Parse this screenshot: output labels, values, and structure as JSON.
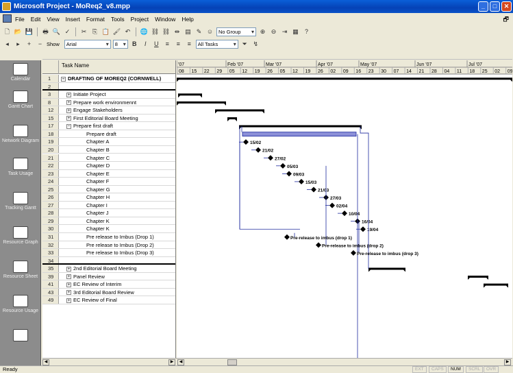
{
  "window": {
    "title": "Microsoft Project - MoReq2_v8.mpp"
  },
  "menu": [
    "File",
    "Edit",
    "View",
    "Insert",
    "Format",
    "Tools",
    "Project",
    "Window",
    "Help"
  ],
  "toolbar": {
    "group_value": "No Group",
    "font_value": "Arial",
    "font_size": "8",
    "filter_value": "All Tasks",
    "show_label": "Show"
  },
  "views": [
    "Calendar",
    "Gantt Chart",
    "Network Diagram",
    "Task Usage",
    "Tracking Gantt",
    "Resource Graph",
    "Resource Sheet",
    "Resource Usage"
  ],
  "table": {
    "header": "Task Name",
    "rows": [
      {
        "id": "1",
        "name": "DRAFTING OF MOREQ2 (CORNWELL)",
        "toggle": "−",
        "indent": 0,
        "bold": true
      },
      {
        "id": "2",
        "name": "",
        "toggle": "",
        "indent": 1,
        "bold": false
      },
      {
        "id": "3",
        "name": "Initiate Project",
        "toggle": "+",
        "indent": 1,
        "bold": false
      },
      {
        "id": "8",
        "name": "Prepare work environmennt",
        "toggle": "+",
        "indent": 1,
        "bold": false
      },
      {
        "id": "12",
        "name": "Engage Stakeholders",
        "toggle": "+",
        "indent": 1,
        "bold": false
      },
      {
        "id": "15",
        "name": "First Editorial Board Meeting",
        "toggle": "+",
        "indent": 1,
        "bold": false
      },
      {
        "id": "17",
        "name": "Prepare first draft",
        "toggle": "−",
        "indent": 1,
        "bold": false
      },
      {
        "id": "18",
        "name": "Prepare draft",
        "toggle": "",
        "indent": 2,
        "bold": false
      },
      {
        "id": "19",
        "name": "Chapter A",
        "toggle": "",
        "indent": 2,
        "bold": false
      },
      {
        "id": "20",
        "name": "Chapter B",
        "toggle": "",
        "indent": 2,
        "bold": false
      },
      {
        "id": "21",
        "name": "Chapter C",
        "toggle": "",
        "indent": 2,
        "bold": false
      },
      {
        "id": "22",
        "name": "Chapter D",
        "toggle": "",
        "indent": 2,
        "bold": false
      },
      {
        "id": "23",
        "name": "Chapter E",
        "toggle": "",
        "indent": 2,
        "bold": false
      },
      {
        "id": "24",
        "name": "Chapter F",
        "toggle": "",
        "indent": 2,
        "bold": false
      },
      {
        "id": "25",
        "name": "Chapter G",
        "toggle": "",
        "indent": 2,
        "bold": false
      },
      {
        "id": "26",
        "name": "Chapter H",
        "toggle": "",
        "indent": 2,
        "bold": false
      },
      {
        "id": "27",
        "name": "Chapter I",
        "toggle": "",
        "indent": 2,
        "bold": false
      },
      {
        "id": "28",
        "name": "Chapter J",
        "toggle": "",
        "indent": 2,
        "bold": false
      },
      {
        "id": "29",
        "name": "Chapter K",
        "toggle": "",
        "indent": 2,
        "bold": false
      },
      {
        "id": "30",
        "name": "Chapter K",
        "toggle": "",
        "indent": 2,
        "bold": false
      },
      {
        "id": "31",
        "name": "Pre release to Imbus (Drop 1)",
        "toggle": "",
        "indent": 2,
        "bold": false
      },
      {
        "id": "32",
        "name": "Pre release to Imbus (Drop 2)",
        "toggle": "",
        "indent": 2,
        "bold": false
      },
      {
        "id": "33",
        "name": "Pre release to Imbus (Drop 3)",
        "toggle": "",
        "indent": 2,
        "bold": false
      },
      {
        "id": "34",
        "name": "",
        "toggle": "",
        "indent": 1,
        "bold": false
      },
      {
        "id": "35",
        "name": "2nd Editorial Board Meeting",
        "toggle": "+",
        "indent": 1,
        "bold": false
      },
      {
        "id": "39",
        "name": "Panel Review",
        "toggle": "+",
        "indent": 1,
        "bold": false
      },
      {
        "id": "41",
        "name": "EC Review of Interim",
        "toggle": "+",
        "indent": 1,
        "bold": false
      },
      {
        "id": "43",
        "name": "3rd Editorial Board Review",
        "toggle": "+",
        "indent": 1,
        "bold": false
      },
      {
        "id": "49",
        "name": "EC Review of Final",
        "toggle": "+",
        "indent": 1,
        "bold": false
      }
    ]
  },
  "timescale": {
    "months": [
      "'07",
      "Feb '07",
      "Mar '07",
      "Apr '07",
      "May '07",
      "Jun '07",
      "Jul '07"
    ],
    "days": [
      "08",
      "15",
      "22",
      "29",
      "05",
      "12",
      "19",
      "26",
      "05",
      "12",
      "19",
      "26",
      "02",
      "09",
      "16",
      "23",
      "30",
      "07",
      "14",
      "21",
      "28",
      "04",
      "11",
      "18",
      "25",
      "02",
      "09"
    ]
  },
  "milestone_labels": [
    "15/02",
    "21/02",
    "27/02",
    "05/03",
    "09/03",
    "15/03",
    "21/03",
    "27/03",
    "02/04",
    "10/04",
    "16/04",
    "19/04",
    "Pre-release to imbus (drop 1)",
    "Pre-release to imbus (drop 2)",
    "Pre-release to imbus (drop 3)"
  ],
  "colors": {
    "summary": "#000000",
    "task_bar": "#8b8fd8",
    "link": "#1e2a9e"
  },
  "status": {
    "text": "Ready",
    "indicators": [
      "EXT",
      "CAPS",
      "NUM",
      "SCRL",
      "OVR"
    ]
  }
}
